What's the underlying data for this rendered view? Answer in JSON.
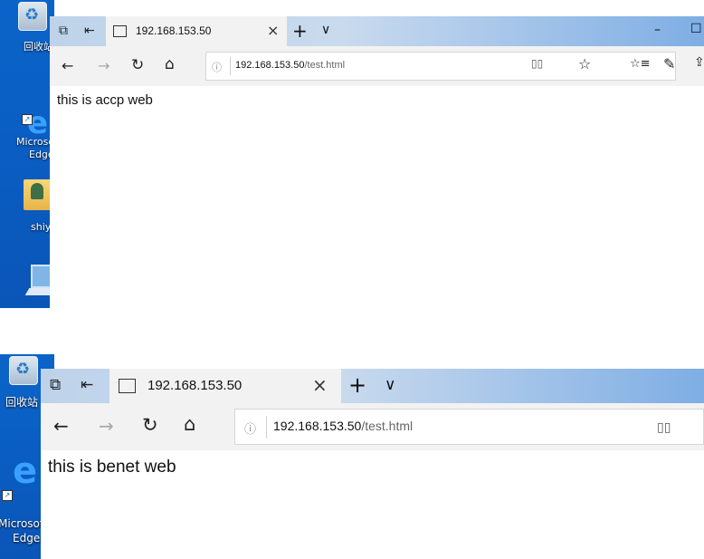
{
  "desktop": {
    "recycle_bin_label": "回收站",
    "edge_label_line1": "Microsoft",
    "edge_label_line2": "Edge",
    "user_folder_label": "shiyu"
  },
  "screens": [
    {
      "tab": {
        "title": "192.168.153.50",
        "close_icon": "×"
      },
      "toolbar": {
        "new_tab": "+",
        "tab_menu": "∨",
        "minimize": "–",
        "maximize": "☐"
      },
      "nav": {
        "back": "←",
        "forward": "→",
        "refresh": "↻",
        "home": "⌂",
        "reading_view": "📖",
        "favorite": "☆",
        "favorites_hub": "☆≡",
        "notes": "✎",
        "share": "⇪"
      },
      "address": {
        "info": "ⓘ",
        "host": "192.168.153.50",
        "path": "/test.html"
      },
      "content": {
        "text": "this is accp web"
      }
    },
    {
      "tab": {
        "title": "192.168.153.50",
        "close_icon": "×"
      },
      "toolbar": {
        "new_tab": "+",
        "tab_menu": "∨"
      },
      "nav": {
        "back": "←",
        "forward": "→",
        "refresh": "↻",
        "home": "⌂",
        "reading_view": "📖"
      },
      "address": {
        "info": "ⓘ",
        "host": "192.168.153.50",
        "path": "/test.html"
      },
      "content": {
        "text": "this is benet web"
      }
    }
  ]
}
